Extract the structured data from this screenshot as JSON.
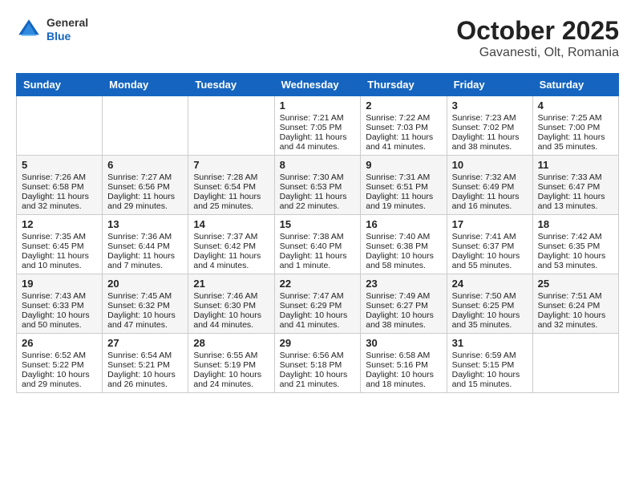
{
  "header": {
    "logo_general": "General",
    "logo_blue": "Blue",
    "title": "October 2025",
    "subtitle": "Gavanesti, Olt, Romania"
  },
  "weekdays": [
    "Sunday",
    "Monday",
    "Tuesday",
    "Wednesday",
    "Thursday",
    "Friday",
    "Saturday"
  ],
  "weeks": [
    [
      {
        "day": "",
        "content": ""
      },
      {
        "day": "",
        "content": ""
      },
      {
        "day": "",
        "content": ""
      },
      {
        "day": "1",
        "content": "Sunrise: 7:21 AM\nSunset: 7:05 PM\nDaylight: 11 hours and 44 minutes."
      },
      {
        "day": "2",
        "content": "Sunrise: 7:22 AM\nSunset: 7:03 PM\nDaylight: 11 hours and 41 minutes."
      },
      {
        "day": "3",
        "content": "Sunrise: 7:23 AM\nSunset: 7:02 PM\nDaylight: 11 hours and 38 minutes."
      },
      {
        "day": "4",
        "content": "Sunrise: 7:25 AM\nSunset: 7:00 PM\nDaylight: 11 hours and 35 minutes."
      }
    ],
    [
      {
        "day": "5",
        "content": "Sunrise: 7:26 AM\nSunset: 6:58 PM\nDaylight: 11 hours and 32 minutes."
      },
      {
        "day": "6",
        "content": "Sunrise: 7:27 AM\nSunset: 6:56 PM\nDaylight: 11 hours and 29 minutes."
      },
      {
        "day": "7",
        "content": "Sunrise: 7:28 AM\nSunset: 6:54 PM\nDaylight: 11 hours and 25 minutes."
      },
      {
        "day": "8",
        "content": "Sunrise: 7:30 AM\nSunset: 6:53 PM\nDaylight: 11 hours and 22 minutes."
      },
      {
        "day": "9",
        "content": "Sunrise: 7:31 AM\nSunset: 6:51 PM\nDaylight: 11 hours and 19 minutes."
      },
      {
        "day": "10",
        "content": "Sunrise: 7:32 AM\nSunset: 6:49 PM\nDaylight: 11 hours and 16 minutes."
      },
      {
        "day": "11",
        "content": "Sunrise: 7:33 AM\nSunset: 6:47 PM\nDaylight: 11 hours and 13 minutes."
      }
    ],
    [
      {
        "day": "12",
        "content": "Sunrise: 7:35 AM\nSunset: 6:45 PM\nDaylight: 11 hours and 10 minutes."
      },
      {
        "day": "13",
        "content": "Sunrise: 7:36 AM\nSunset: 6:44 PM\nDaylight: 11 hours and 7 minutes."
      },
      {
        "day": "14",
        "content": "Sunrise: 7:37 AM\nSunset: 6:42 PM\nDaylight: 11 hours and 4 minutes."
      },
      {
        "day": "15",
        "content": "Sunrise: 7:38 AM\nSunset: 6:40 PM\nDaylight: 11 hours and 1 minute."
      },
      {
        "day": "16",
        "content": "Sunrise: 7:40 AM\nSunset: 6:38 PM\nDaylight: 10 hours and 58 minutes."
      },
      {
        "day": "17",
        "content": "Sunrise: 7:41 AM\nSunset: 6:37 PM\nDaylight: 10 hours and 55 minutes."
      },
      {
        "day": "18",
        "content": "Sunrise: 7:42 AM\nSunset: 6:35 PM\nDaylight: 10 hours and 53 minutes."
      }
    ],
    [
      {
        "day": "19",
        "content": "Sunrise: 7:43 AM\nSunset: 6:33 PM\nDaylight: 10 hours and 50 minutes."
      },
      {
        "day": "20",
        "content": "Sunrise: 7:45 AM\nSunset: 6:32 PM\nDaylight: 10 hours and 47 minutes."
      },
      {
        "day": "21",
        "content": "Sunrise: 7:46 AM\nSunset: 6:30 PM\nDaylight: 10 hours and 44 minutes."
      },
      {
        "day": "22",
        "content": "Sunrise: 7:47 AM\nSunset: 6:29 PM\nDaylight: 10 hours and 41 minutes."
      },
      {
        "day": "23",
        "content": "Sunrise: 7:49 AM\nSunset: 6:27 PM\nDaylight: 10 hours and 38 minutes."
      },
      {
        "day": "24",
        "content": "Sunrise: 7:50 AM\nSunset: 6:25 PM\nDaylight: 10 hours and 35 minutes."
      },
      {
        "day": "25",
        "content": "Sunrise: 7:51 AM\nSunset: 6:24 PM\nDaylight: 10 hours and 32 minutes."
      }
    ],
    [
      {
        "day": "26",
        "content": "Sunrise: 6:52 AM\nSunset: 5:22 PM\nDaylight: 10 hours and 29 minutes."
      },
      {
        "day": "27",
        "content": "Sunrise: 6:54 AM\nSunset: 5:21 PM\nDaylight: 10 hours and 26 minutes."
      },
      {
        "day": "28",
        "content": "Sunrise: 6:55 AM\nSunset: 5:19 PM\nDaylight: 10 hours and 24 minutes."
      },
      {
        "day": "29",
        "content": "Sunrise: 6:56 AM\nSunset: 5:18 PM\nDaylight: 10 hours and 21 minutes."
      },
      {
        "day": "30",
        "content": "Sunrise: 6:58 AM\nSunset: 5:16 PM\nDaylight: 10 hours and 18 minutes."
      },
      {
        "day": "31",
        "content": "Sunrise: 6:59 AM\nSunset: 5:15 PM\nDaylight: 10 hours and 15 minutes."
      },
      {
        "day": "",
        "content": ""
      }
    ]
  ]
}
